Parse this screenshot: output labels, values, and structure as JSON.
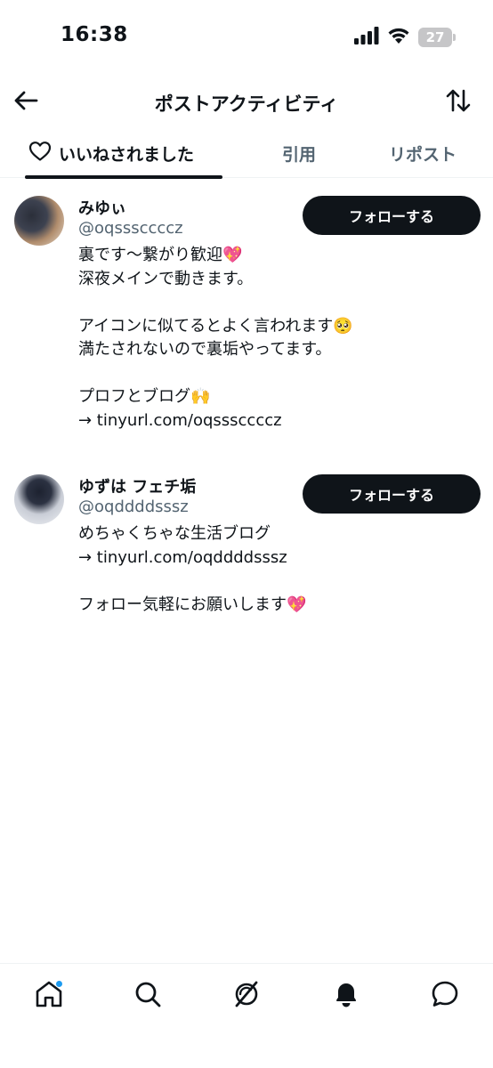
{
  "status_bar": {
    "time": "16:38",
    "battery": "27"
  },
  "header": {
    "title": "ポストアクティビティ"
  },
  "tabs": [
    {
      "label": "いいねされました",
      "active": true
    },
    {
      "label": "引用",
      "active": false
    },
    {
      "label": "リポスト",
      "active": false
    }
  ],
  "users": [
    {
      "name": "みゆぃ",
      "handle": "@oqsssccccz",
      "follow_label": "フォローする",
      "bio_lines": [
        "裏です〜繋がり歓迎💖",
        "深夜メインで動きます。",
        "",
        "アイコンに似てるとよく言われます🥺",
        "満たされないので裏垢やってます。",
        "",
        "プロフとブログ🙌",
        "→ tinyurl.com/oqsssccccz"
      ]
    },
    {
      "name": "ゆずは フェチ垢",
      "handle": "@oqddddsssz",
      "follow_label": "フォローする",
      "bio_lines": [
        "めちゃくちゃな生活ブログ",
        "→ tinyurl.com/oqddddsssz",
        "",
        "フォロー気軽にお願いします💖"
      ]
    }
  ],
  "icons": {
    "back": "arrow-left-icon",
    "sort": "sort-arrows-icon",
    "tab_likes": "heart-outline-icon",
    "nav": [
      "home-icon",
      "search-icon",
      "grok-icon",
      "bell-icon",
      "chat-bubble-icon"
    ]
  },
  "colors": {
    "text": "#0f1419",
    "secondary": "#536471",
    "accent": "#1d9bf0",
    "button": "#0f1419"
  }
}
